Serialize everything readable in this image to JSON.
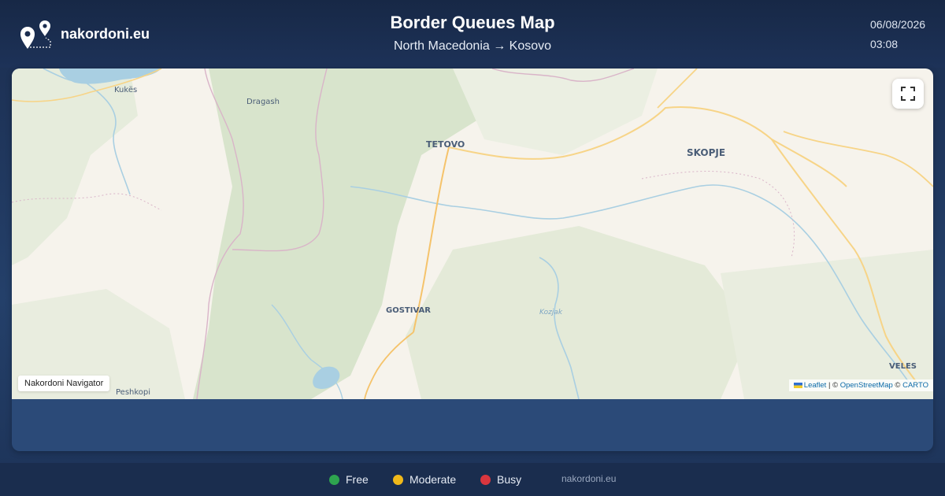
{
  "header": {
    "brand": "nakordoni.eu",
    "title": "Border Queues Map",
    "route": "North Macedonia → Kosovo",
    "date": "06/08/2026",
    "time": "03:08"
  },
  "map": {
    "cities": [
      "Kukës",
      "Dragash",
      "TETOVO",
      "SKOPJE",
      "GOSTIVAR",
      "Kozjak",
      "VELES",
      "Peshkopi"
    ],
    "nav_label": "Nakordoni Navigator",
    "attribution": {
      "leaflet": "Leaflet",
      "sep1": " | © ",
      "osm": "OpenStreetMap",
      "sep2": " © ",
      "carto": "CARTO"
    }
  },
  "legend": {
    "free": {
      "label": "Free",
      "color": "#2ea44f"
    },
    "moderate": {
      "label": "Moderate",
      "color": "#f0b91a"
    },
    "busy": {
      "label": "Busy",
      "color": "#d9363e"
    }
  },
  "footer": {
    "site": "nakordoni.eu"
  }
}
